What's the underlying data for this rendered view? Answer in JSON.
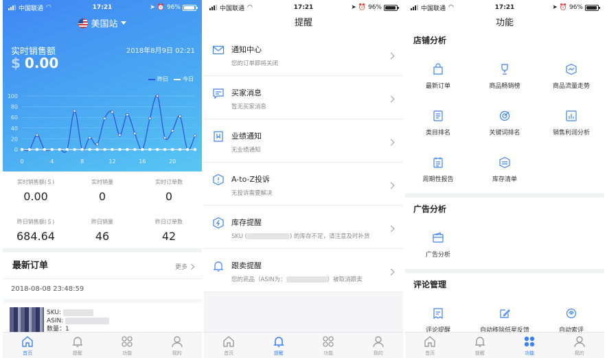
{
  "status": {
    "carrier": "中国联通",
    "time": "17:21",
    "battery": "96%"
  },
  "colors": {
    "accent": "#3b82f6",
    "hero_top": "#3f86f3",
    "hero_bottom": "#58c7f3"
  },
  "home": {
    "site": "美国站",
    "realtime_label": "实时销售额",
    "realtime_date": "2018年8月9日 02:21",
    "currency": "$",
    "realtime_value": "0.00",
    "legend_yesterday": "昨日",
    "legend_today": "今日",
    "stats": [
      {
        "label": "实时销售额(＄)",
        "value": "0.00"
      },
      {
        "label": "实时销量",
        "value": "0"
      },
      {
        "label": "实时订单数",
        "value": "0"
      },
      {
        "label": "昨日销售额(＄)",
        "value": "684.64"
      },
      {
        "label": "昨日销量",
        "value": "46"
      },
      {
        "label": "昨日订单数",
        "value": "42"
      }
    ],
    "orders_title": "最新订单",
    "more": "更多",
    "order_time": "2018-08-08 23:48:59",
    "sku_label": "SKU:",
    "asin_label": "ASIN:",
    "qty_label": "数量：1"
  },
  "chart_data": {
    "type": "line",
    "x": [
      0,
      1,
      2,
      3,
      4,
      5,
      6,
      7,
      8,
      9,
      10,
      11,
      12,
      13,
      14,
      15,
      16,
      17,
      18,
      19,
      20,
      21,
      22,
      23
    ],
    "x_ticks": [
      "0",
      "4",
      "8",
      "12",
      "16",
      "20"
    ],
    "y_ticks": [
      "0",
      "20",
      "40",
      "60",
      "80",
      "100"
    ],
    "ylim": [
      0,
      105
    ],
    "series": [
      {
        "name": "昨日",
        "color": "#2f55d4",
        "values": [
          0,
          0,
          27,
          0,
          0,
          0,
          0,
          72,
          0,
          22,
          10,
          58,
          70,
          27,
          65,
          30,
          0,
          58,
          100,
          22,
          35,
          62,
          0,
          26
        ]
      },
      {
        "name": "今日",
        "color": "#ffffff",
        "values": [
          0,
          0,
          0,
          0,
          0,
          0,
          0,
          0,
          0,
          0,
          0,
          0,
          0,
          0,
          0,
          0,
          0,
          0,
          0,
          0,
          0,
          0,
          0,
          0
        ]
      }
    ]
  },
  "alerts": {
    "title": "提醒",
    "items": [
      {
        "title": "通知中心",
        "sub": "您的订单即将关闭",
        "icon": "mail-icon"
      },
      {
        "title": "买家消息",
        "sub": "暂无买家消息",
        "icon": "message-icon"
      },
      {
        "title": "业绩通知",
        "sub": "无业绩通知",
        "icon": "performance-icon"
      },
      {
        "title": "A-to-Z投诉",
        "sub": "无投诉需要解决",
        "icon": "warning-icon"
      },
      {
        "title": "库存提醒",
        "sub": "SKU (",
        "sub2": ") 的库存不足，请注意及时补货",
        "icon": "inventory-icon"
      },
      {
        "title": "跟卖提醒",
        "sub": "您的商品（ASIN为：",
        "sub2": "）被取消跟卖",
        "icon": "bell-icon"
      }
    ]
  },
  "functions": {
    "title": "功能",
    "shop_title": "店铺分析",
    "shop_items": [
      "最新订单",
      "商品畅销榜",
      "商品流量走势",
      "类目排名",
      "关键词排名",
      "销售利润分析",
      "周期性报告",
      "库存清单"
    ],
    "ad_title": "广告分析",
    "ad_items": [
      "广告分析"
    ],
    "review_title": "评论管理",
    "review_items": [
      "评论提醒",
      "自动移除低星反馈",
      "自动索评"
    ]
  },
  "tabs": [
    "首页",
    "提醒",
    "功能",
    "我的"
  ]
}
